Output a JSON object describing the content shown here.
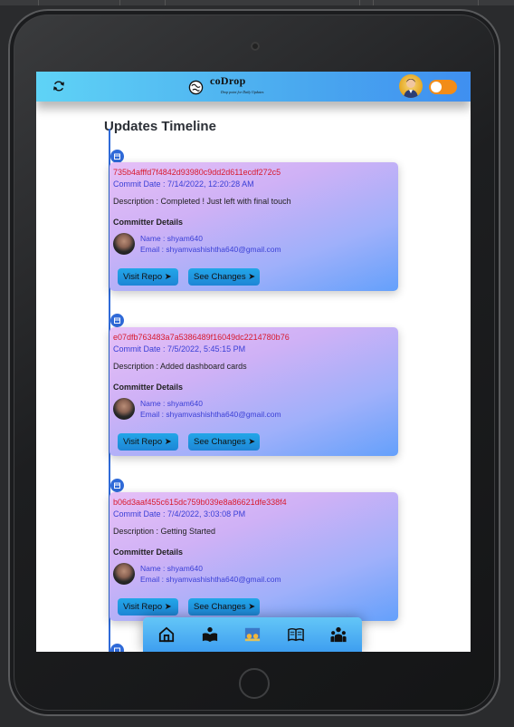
{
  "app": {
    "logo_text": "coDrop",
    "logo_tagline": "Drop point for Daily Updates"
  },
  "timeline": {
    "heading": "Updates Timeline",
    "commits": [
      {
        "sha": "735b4afffd7f4842d93980c9dd2d611ecdf272c5",
        "date": "Commit Date : 7/14/2022, 12:20:28 AM",
        "description": "Description : Completed ! Just left with final touch",
        "committer_title": "Committer Details",
        "name": "Name : shyam640",
        "email": "Email : shyamvashishtha640@gmail.com",
        "visit_label": "Visit Repo",
        "see_label": "See Changes"
      },
      {
        "sha": "e07dfb763483a7a5386489f16049dc2214780b76",
        "date": "Commit Date : 7/5/2022, 5:45:15 PM",
        "description": "Description : Added dashboard cards",
        "committer_title": "Committer Details",
        "name": "Name : shyam640",
        "email": "Email : shyamvashishtha640@gmail.com",
        "visit_label": "Visit Repo",
        "see_label": "See Changes"
      },
      {
        "sha": "b06d3aaf455c615dc759b039e8a86621dfe338f4",
        "date": "Commit Date : 7/4/2022, 3:03:08 PM",
        "description": "Description : Getting Started",
        "committer_title": "Committer Details",
        "name": "Name : shyam640",
        "email": "Email : shyamvashishtha640@gmail.com",
        "visit_label": "Visit Repo",
        "see_label": "See Changes"
      }
    ]
  },
  "bottom_nav": [
    "home-icon",
    "reader-icon",
    "gallery-icon",
    "book-icon",
    "team-icon"
  ],
  "colors": {
    "accent": "#3f8ff0",
    "timeline_line": "#2f6ad8",
    "sha_text": "#d81a2e",
    "link_text": "#3a3fd6",
    "toggle": "#f28c18"
  }
}
